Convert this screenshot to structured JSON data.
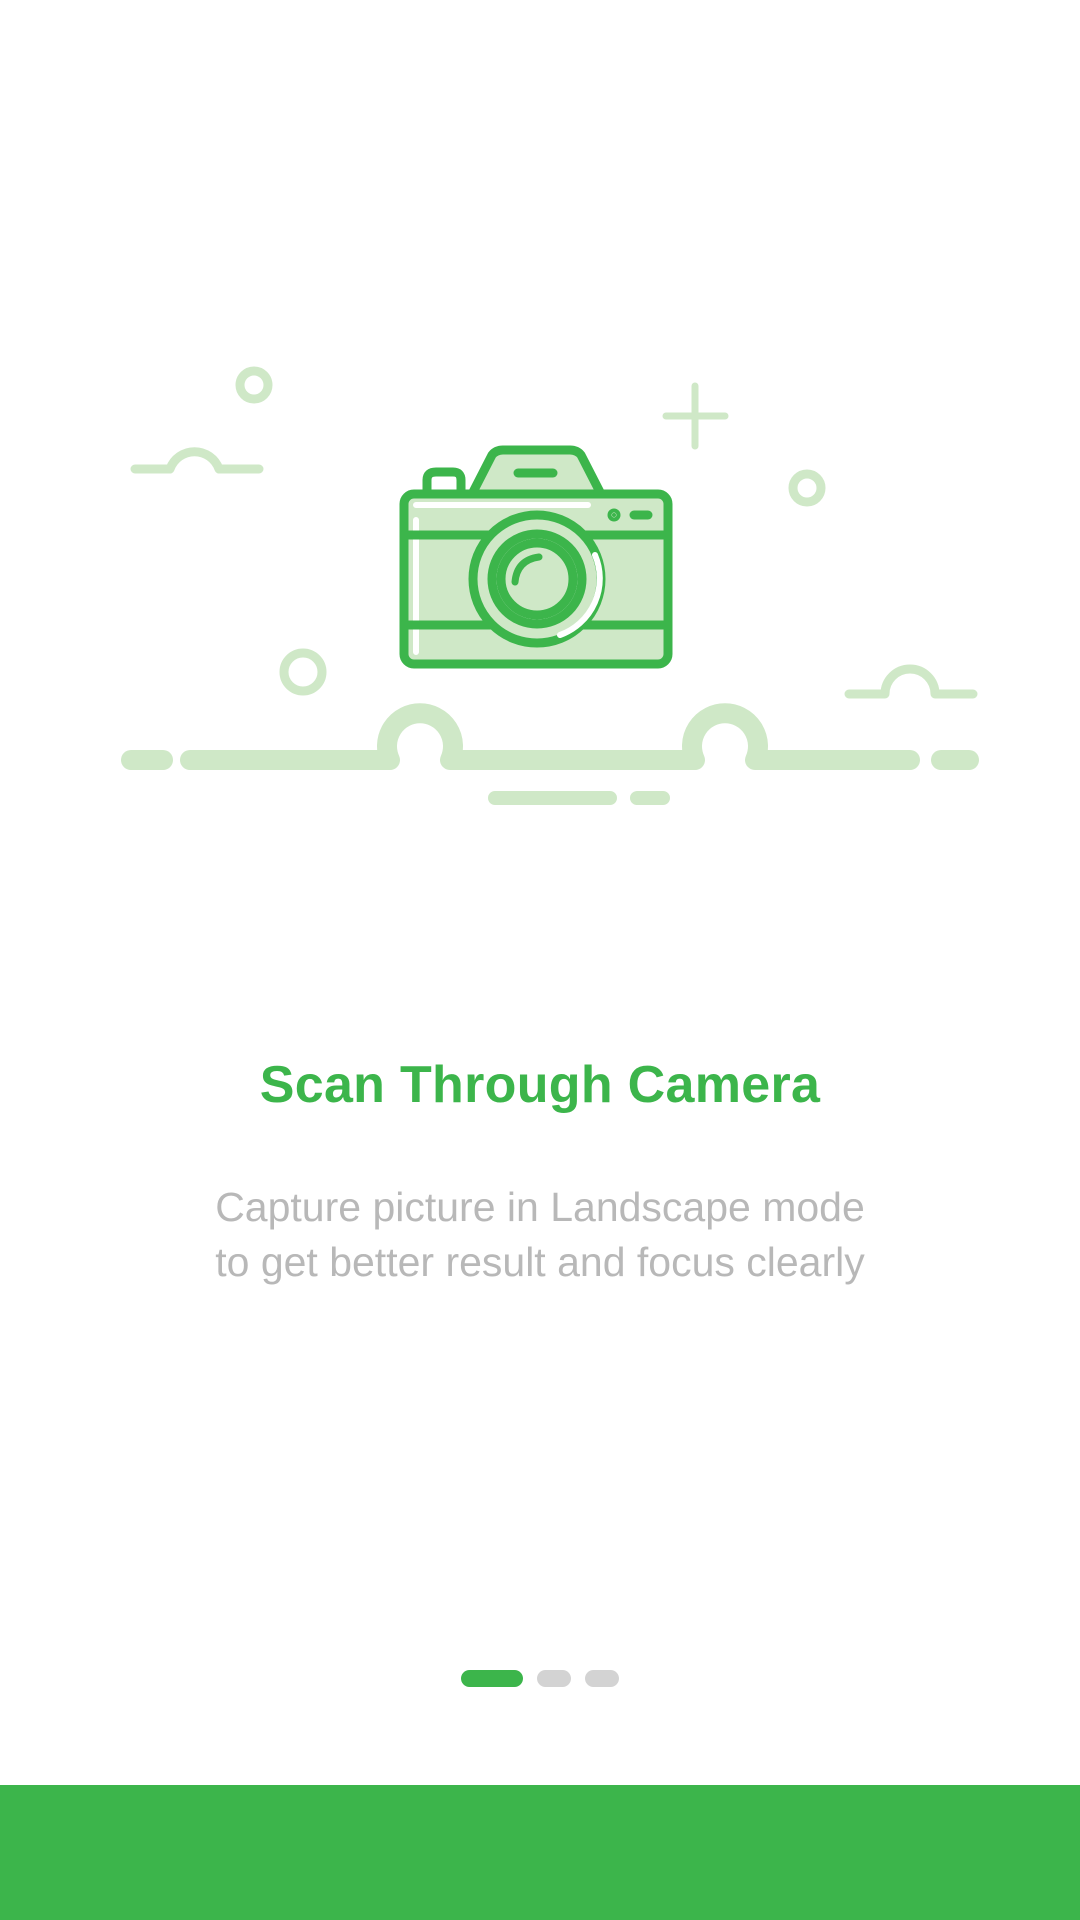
{
  "colors": {
    "primary": "#3cb54b",
    "light": "#cfe8c7",
    "muted_text": "#b8b8b8",
    "inactive_dot": "#d3d3d3",
    "background": "#ffffff"
  },
  "illustration": {
    "icon": "camera-icon"
  },
  "onboarding": {
    "title": "Scan Through Camera",
    "description_lines": [
      "Capture picture in Landscape mode",
      "to get better result and focus clearly"
    ]
  },
  "pager": {
    "total_pages": 3,
    "current_page": 1
  }
}
